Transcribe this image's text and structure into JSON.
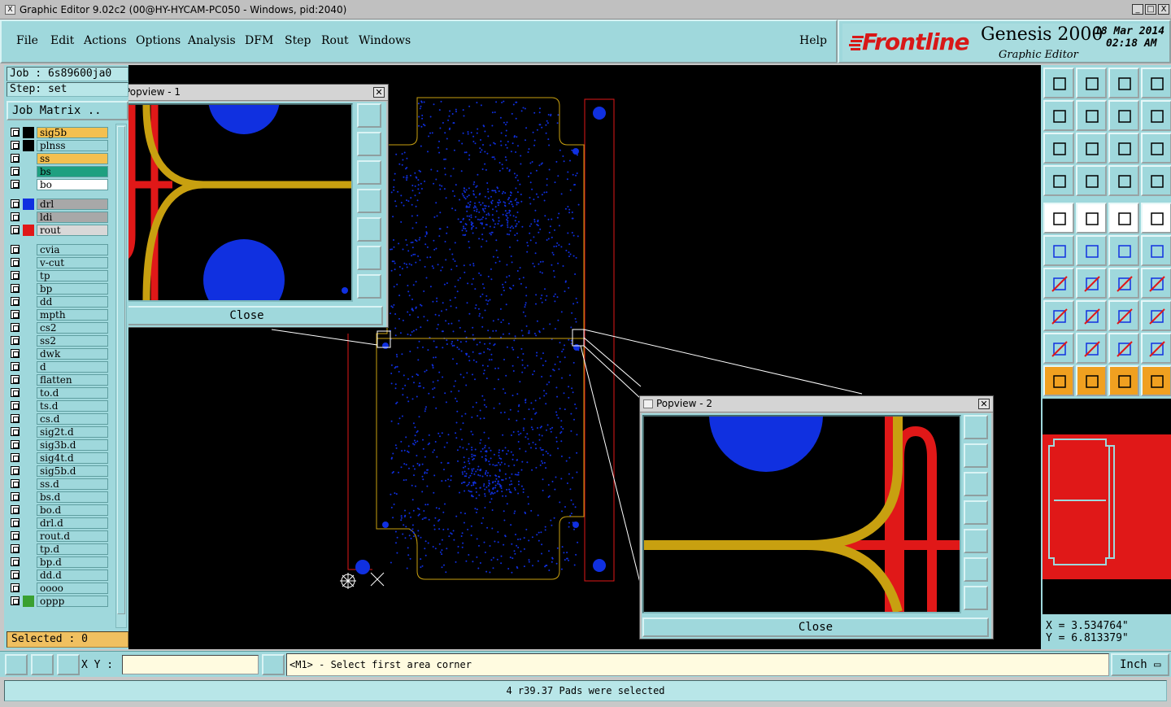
{
  "window": {
    "title": "Graphic Editor 9.02c2 (00@HY-HYCAM-PC050 - Windows, pid:2040)",
    "buttons": [
      "_",
      "□",
      "X"
    ]
  },
  "menu": {
    "items": [
      "File",
      "Edit",
      "Actions",
      "Options",
      "Analysis",
      "DFM",
      "Step",
      "Rout",
      "Windows"
    ],
    "help": "Help"
  },
  "brand": {
    "logo": "Frontline",
    "product": "Genesis 2000",
    "subtitle": "Graphic Editor",
    "date": "18 Mar 2014",
    "time": "02:18 AM",
    "logo_color": "#d81818"
  },
  "left": {
    "job": "Job : 6s89600ja0",
    "step": "Step: set",
    "job_matrix": "Job Matrix ..",
    "selected": "Selected : 0",
    "layers": [
      {
        "name": "sig5b",
        "color": "#f4c050",
        "swatch": "#000000"
      },
      {
        "name": "plnss",
        "color": "#9fd8dc",
        "swatch": "#000000"
      },
      {
        "name": "ss",
        "color": "#f4c050",
        "swatch": ""
      },
      {
        "name": "bs",
        "color": "#1ea080",
        "swatch": ""
      },
      {
        "name": "bo",
        "color": "#ffffff",
        "swatch": ""
      },
      {
        "name": "drl",
        "color": "#a8a8a8",
        "swatch": "#1030e0"
      },
      {
        "name": "ldi",
        "color": "#a8a8a8",
        "swatch": ""
      },
      {
        "name": "rout",
        "color": "#d8d8d8",
        "swatch": "#e01818"
      },
      {
        "name": "cvia",
        "color": "#9fd8dc",
        "swatch": ""
      },
      {
        "name": "v-cut",
        "color": "#9fd8dc",
        "swatch": ""
      },
      {
        "name": "tp",
        "color": "#9fd8dc",
        "swatch": ""
      },
      {
        "name": "bp",
        "color": "#9fd8dc",
        "swatch": ""
      },
      {
        "name": "dd",
        "color": "#9fd8dc",
        "swatch": ""
      },
      {
        "name": "mpth",
        "color": "#9fd8dc",
        "swatch": ""
      },
      {
        "name": "cs2",
        "color": "#9fd8dc",
        "swatch": ""
      },
      {
        "name": "ss2",
        "color": "#9fd8dc",
        "swatch": ""
      },
      {
        "name": "dwk",
        "color": "#9fd8dc",
        "swatch": ""
      },
      {
        "name": "d",
        "color": "#9fd8dc",
        "swatch": ""
      },
      {
        "name": "flatten",
        "color": "#9fd8dc",
        "swatch": ""
      },
      {
        "name": "to.d",
        "color": "#9fd8dc",
        "swatch": ""
      },
      {
        "name": "ts.d",
        "color": "#9fd8dc",
        "swatch": ""
      },
      {
        "name": "cs.d",
        "color": "#9fd8dc",
        "swatch": ""
      },
      {
        "name": "sig2t.d",
        "color": "#9fd8dc",
        "swatch": ""
      },
      {
        "name": "sig3b.d",
        "color": "#9fd8dc",
        "swatch": ""
      },
      {
        "name": "sig4t.d",
        "color": "#9fd8dc",
        "swatch": ""
      },
      {
        "name": "sig5b.d",
        "color": "#9fd8dc",
        "swatch": ""
      },
      {
        "name": "ss.d",
        "color": "#9fd8dc",
        "swatch": ""
      },
      {
        "name": "bs.d",
        "color": "#9fd8dc",
        "swatch": ""
      },
      {
        "name": "bo.d",
        "color": "#9fd8dc",
        "swatch": ""
      },
      {
        "name": "drl.d",
        "color": "#9fd8dc",
        "swatch": ""
      },
      {
        "name": "rout.d",
        "color": "#9fd8dc",
        "swatch": ""
      },
      {
        "name": "tp.d",
        "color": "#9fd8dc",
        "swatch": ""
      },
      {
        "name": "bp.d",
        "color": "#9fd8dc",
        "swatch": ""
      },
      {
        "name": "dd.d",
        "color": "#9fd8dc",
        "swatch": ""
      },
      {
        "name": "oooo",
        "color": "#9fd8dc",
        "swatch": ""
      },
      {
        "name": "oppp",
        "color": "#9fd8dc",
        "swatch": "#3aa030"
      }
    ]
  },
  "popview1": {
    "title": "Popview - 1",
    "close": "Close"
  },
  "popview2": {
    "title": "Popview - 2",
    "close": "Close"
  },
  "coords": {
    "x": "X = 3.534764\"",
    "y": "Y = 6.813379\""
  },
  "command": {
    "xy_label": "X Y :",
    "xy_value": "",
    "prompt": "<M1> - Select first area corner",
    "unit": "Inch"
  },
  "status": "4 r39.37 Pads were selected",
  "colors": {
    "panel": "#9fd8dc",
    "pad": "#1030e0",
    "trace": "#c8a010",
    "rout": "#e01818"
  }
}
